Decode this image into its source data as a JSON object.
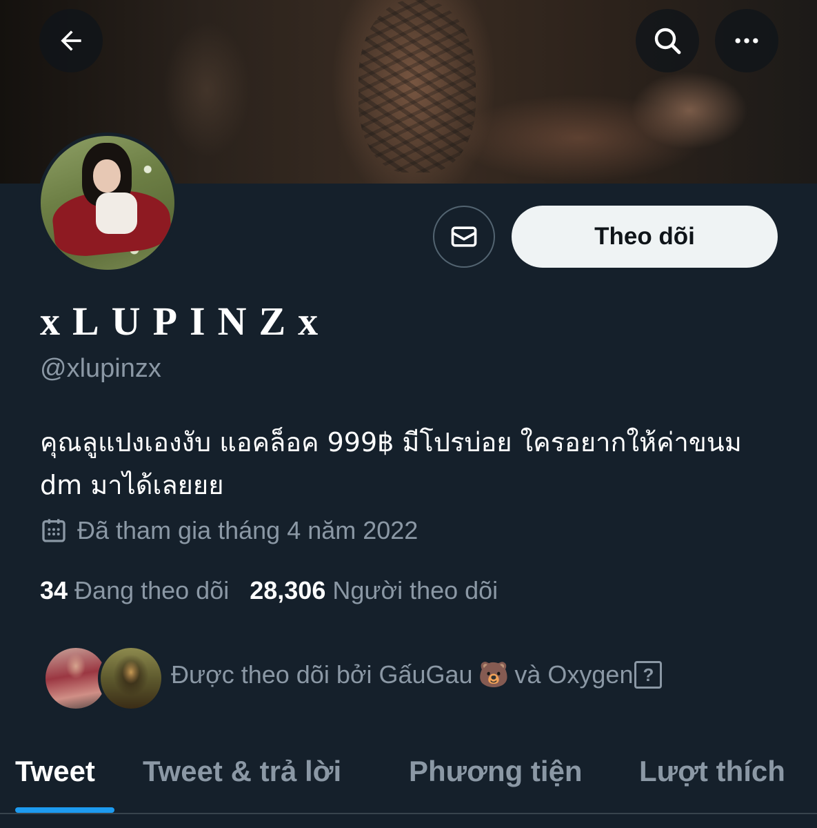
{
  "header": {
    "back_icon": "arrow-left-icon",
    "search_icon": "search-icon",
    "more_icon": "more-horizontal-icon"
  },
  "profile": {
    "display_name": "xLUPINZx",
    "handle": "@xlupinzx",
    "bio": "คุณลูแปงเองงับ แอคล็อค 999฿ มีโปรบ่อย ใครอยากให้ค่าขนม dm มาได้เลยยย",
    "joined": "Đã tham gia tháng 4 năm 2022",
    "following_count": "34",
    "following_label": "Đang theo dõi",
    "followers_count": "28,306",
    "followers_label": "Người theo dõi"
  },
  "actions": {
    "message_icon": "envelope-icon",
    "follow_label": "Theo dõi"
  },
  "followed_by": {
    "text": "Được theo dõi bởi GấuGau",
    "emoji": "🐻",
    "text_after": "và Oxygen",
    "suffix": "?"
  },
  "tabs": [
    {
      "label": "Tweet",
      "active": true
    },
    {
      "label": "Tweet & trả lời",
      "active": false
    },
    {
      "label": "Phương tiện",
      "active": false
    },
    {
      "label": "Lượt thích",
      "active": false
    }
  ],
  "colors": {
    "background": "#15202b",
    "secondary_text": "#8b98a5",
    "accent": "#1d9bf0",
    "follow_button": "#eff3f4"
  }
}
